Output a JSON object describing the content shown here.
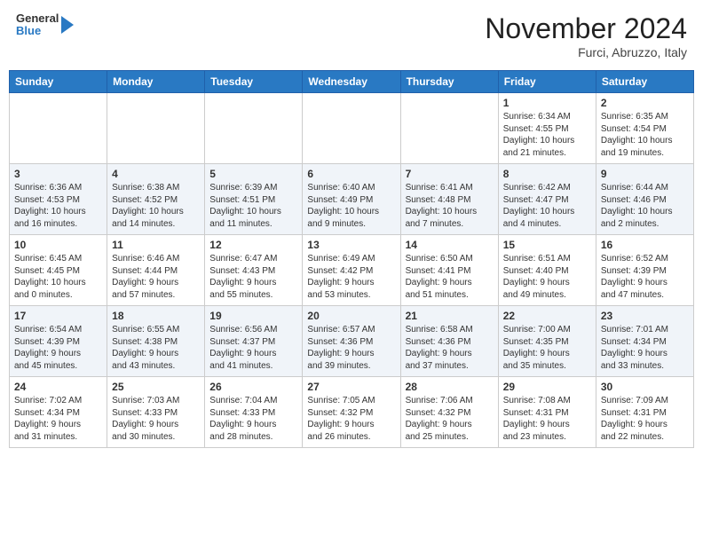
{
  "header": {
    "logo": {
      "line1": "General",
      "line2": "Blue"
    },
    "month": "November 2024",
    "location": "Furci, Abruzzo, Italy"
  },
  "weekdays": [
    "Sunday",
    "Monday",
    "Tuesday",
    "Wednesday",
    "Thursday",
    "Friday",
    "Saturday"
  ],
  "weeks": [
    [
      {
        "day": "",
        "info": ""
      },
      {
        "day": "",
        "info": ""
      },
      {
        "day": "",
        "info": ""
      },
      {
        "day": "",
        "info": ""
      },
      {
        "day": "",
        "info": ""
      },
      {
        "day": "1",
        "info": "Sunrise: 6:34 AM\nSunset: 4:55 PM\nDaylight: 10 hours\nand 21 minutes."
      },
      {
        "day": "2",
        "info": "Sunrise: 6:35 AM\nSunset: 4:54 PM\nDaylight: 10 hours\nand 19 minutes."
      }
    ],
    [
      {
        "day": "3",
        "info": "Sunrise: 6:36 AM\nSunset: 4:53 PM\nDaylight: 10 hours\nand 16 minutes."
      },
      {
        "day": "4",
        "info": "Sunrise: 6:38 AM\nSunset: 4:52 PM\nDaylight: 10 hours\nand 14 minutes."
      },
      {
        "day": "5",
        "info": "Sunrise: 6:39 AM\nSunset: 4:51 PM\nDaylight: 10 hours\nand 11 minutes."
      },
      {
        "day": "6",
        "info": "Sunrise: 6:40 AM\nSunset: 4:49 PM\nDaylight: 10 hours\nand 9 minutes."
      },
      {
        "day": "7",
        "info": "Sunrise: 6:41 AM\nSunset: 4:48 PM\nDaylight: 10 hours\nand 7 minutes."
      },
      {
        "day": "8",
        "info": "Sunrise: 6:42 AM\nSunset: 4:47 PM\nDaylight: 10 hours\nand 4 minutes."
      },
      {
        "day": "9",
        "info": "Sunrise: 6:44 AM\nSunset: 4:46 PM\nDaylight: 10 hours\nand 2 minutes."
      }
    ],
    [
      {
        "day": "10",
        "info": "Sunrise: 6:45 AM\nSunset: 4:45 PM\nDaylight: 10 hours\nand 0 minutes."
      },
      {
        "day": "11",
        "info": "Sunrise: 6:46 AM\nSunset: 4:44 PM\nDaylight: 9 hours\nand 57 minutes."
      },
      {
        "day": "12",
        "info": "Sunrise: 6:47 AM\nSunset: 4:43 PM\nDaylight: 9 hours\nand 55 minutes."
      },
      {
        "day": "13",
        "info": "Sunrise: 6:49 AM\nSunset: 4:42 PM\nDaylight: 9 hours\nand 53 minutes."
      },
      {
        "day": "14",
        "info": "Sunrise: 6:50 AM\nSunset: 4:41 PM\nDaylight: 9 hours\nand 51 minutes."
      },
      {
        "day": "15",
        "info": "Sunrise: 6:51 AM\nSunset: 4:40 PM\nDaylight: 9 hours\nand 49 minutes."
      },
      {
        "day": "16",
        "info": "Sunrise: 6:52 AM\nSunset: 4:39 PM\nDaylight: 9 hours\nand 47 minutes."
      }
    ],
    [
      {
        "day": "17",
        "info": "Sunrise: 6:54 AM\nSunset: 4:39 PM\nDaylight: 9 hours\nand 45 minutes."
      },
      {
        "day": "18",
        "info": "Sunrise: 6:55 AM\nSunset: 4:38 PM\nDaylight: 9 hours\nand 43 minutes."
      },
      {
        "day": "19",
        "info": "Sunrise: 6:56 AM\nSunset: 4:37 PM\nDaylight: 9 hours\nand 41 minutes."
      },
      {
        "day": "20",
        "info": "Sunrise: 6:57 AM\nSunset: 4:36 PM\nDaylight: 9 hours\nand 39 minutes."
      },
      {
        "day": "21",
        "info": "Sunrise: 6:58 AM\nSunset: 4:36 PM\nDaylight: 9 hours\nand 37 minutes."
      },
      {
        "day": "22",
        "info": "Sunrise: 7:00 AM\nSunset: 4:35 PM\nDaylight: 9 hours\nand 35 minutes."
      },
      {
        "day": "23",
        "info": "Sunrise: 7:01 AM\nSunset: 4:34 PM\nDaylight: 9 hours\nand 33 minutes."
      }
    ],
    [
      {
        "day": "24",
        "info": "Sunrise: 7:02 AM\nSunset: 4:34 PM\nDaylight: 9 hours\nand 31 minutes."
      },
      {
        "day": "25",
        "info": "Sunrise: 7:03 AM\nSunset: 4:33 PM\nDaylight: 9 hours\nand 30 minutes."
      },
      {
        "day": "26",
        "info": "Sunrise: 7:04 AM\nSunset: 4:33 PM\nDaylight: 9 hours\nand 28 minutes."
      },
      {
        "day": "27",
        "info": "Sunrise: 7:05 AM\nSunset: 4:32 PM\nDaylight: 9 hours\nand 26 minutes."
      },
      {
        "day": "28",
        "info": "Sunrise: 7:06 AM\nSunset: 4:32 PM\nDaylight: 9 hours\nand 25 minutes."
      },
      {
        "day": "29",
        "info": "Sunrise: 7:08 AM\nSunset: 4:31 PM\nDaylight: 9 hours\nand 23 minutes."
      },
      {
        "day": "30",
        "info": "Sunrise: 7:09 AM\nSunset: 4:31 PM\nDaylight: 9 hours\nand 22 minutes."
      }
    ]
  ]
}
